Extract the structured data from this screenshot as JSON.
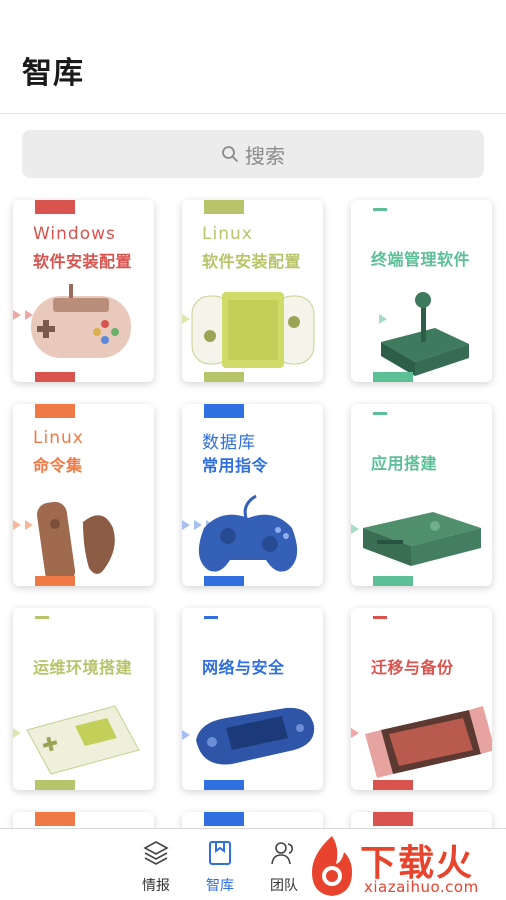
{
  "header": {
    "title": "智库"
  },
  "search": {
    "placeholder": "搜索"
  },
  "cards": [
    {
      "line1": "Windows",
      "line2": "软件安装配置",
      "accent": "#d9534f",
      "device": "snes-controller"
    },
    {
      "line1": "Linux",
      "line2": "软件安装配置",
      "accent": "#b7c46a",
      "device": "handheld-console"
    },
    {
      "line1": "—",
      "line2": "终端管理软件",
      "accent": "#5dbf96",
      "device": "arcade-joystick"
    },
    {
      "line1": "Linux",
      "line2": "命令集",
      "accent": "#ef7a45",
      "device": "wii-remote"
    },
    {
      "line1": "数据库",
      "line2": "常用指令",
      "accent": "#2f6fe0",
      "device": "gamepad"
    },
    {
      "line1": "—",
      "line2": "应用搭建",
      "accent": "#5dbf96",
      "device": "xbox-console"
    },
    {
      "line1": "—",
      "line2": "运维环境搭建",
      "accent": "#b7c46a",
      "device": "gameboy"
    },
    {
      "line1": "—",
      "line2": "网络与安全",
      "accent": "#2f6fe0",
      "device": "psp"
    },
    {
      "line1": "—",
      "line2": "迁移与备份",
      "accent": "#d9534f",
      "device": "nintendo-switch"
    }
  ],
  "tabbar": {
    "items": [
      {
        "label": "情报",
        "icon": "layers-icon"
      },
      {
        "label": "智库",
        "icon": "book-icon",
        "active": true
      },
      {
        "label": "团队",
        "icon": "team-icon"
      }
    ]
  },
  "watermark": {
    "text": "下载火",
    "sub": "xiazaihuo.com"
  },
  "colors": {
    "active": "#2f6fe0",
    "watermark": "#e8432c"
  }
}
